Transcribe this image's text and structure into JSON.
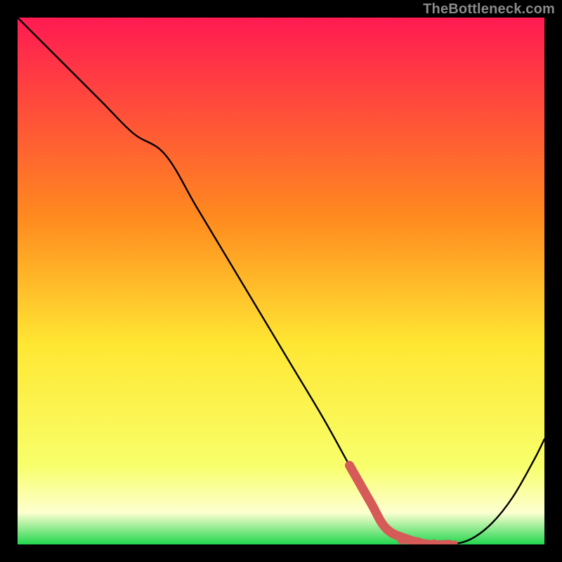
{
  "watermark": "TheBottleneck.com",
  "colors": {
    "gradient_top": "#ff1a52",
    "gradient_upper_mid": "#ff8a1f",
    "gradient_mid": "#ffe733",
    "gradient_lower_mid": "#f8ff6a",
    "gradient_pale": "#fdffd0",
    "gradient_bottom": "#22d64e",
    "curve": "#000000",
    "marker": "#d65a57",
    "frame": "#000000"
  },
  "chart_data": {
    "type": "line",
    "title": "",
    "xlabel": "",
    "ylabel": "",
    "xlim": [
      0,
      100
    ],
    "ylim": [
      0,
      100
    ],
    "grid": false,
    "legend_position": "none",
    "series": [
      {
        "name": "bottleneck-curve",
        "x": [
          0,
          8,
          16,
          22,
          28,
          34,
          40,
          46,
          52,
          58,
          63,
          67,
          70,
          74,
          78,
          82,
          86,
          90,
          94,
          98,
          100
        ],
        "y": [
          100,
          92,
          84,
          78,
          74,
          64,
          54,
          44,
          34,
          24,
          15,
          8,
          3,
          1,
          0,
          0,
          1,
          4,
          9,
          16,
          20
        ]
      }
    ],
    "highlight_segment": {
      "name": "optimal-range",
      "x": [
        63,
        67,
        70,
        74,
        78,
        82
      ],
      "y": [
        15,
        8,
        3,
        1,
        0,
        0
      ]
    },
    "highlight_dots": {
      "name": "marker-dots",
      "x": [
        73,
        76,
        79,
        83
      ],
      "y": [
        1,
        0.5,
        0.3,
        0.2
      ]
    }
  }
}
